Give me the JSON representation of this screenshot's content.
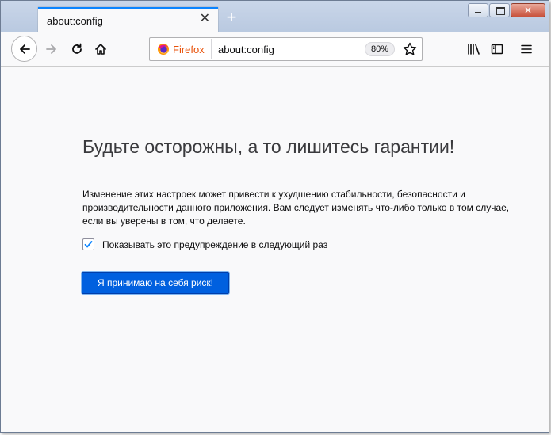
{
  "tab": {
    "title": "about:config",
    "close_glyph": "✕"
  },
  "new_tab_glyph": "+",
  "window_controls": [
    "minimize",
    "maximize",
    "close"
  ],
  "toolbar": {
    "back_icon": "back-arrow-icon",
    "forward_icon": "forward-arrow-icon",
    "reload_icon": "reload-icon",
    "home_icon": "home-icon",
    "library_icon": "library-icon",
    "sidebar_icon": "sidebar-icon",
    "menu_icon": "hamburger-menu-icon"
  },
  "urlbar": {
    "identity_label": "Firefox",
    "url": "about:config",
    "zoom": "80%"
  },
  "page": {
    "title": "Будьте осторожны, а то лишитесь гарантии!",
    "description": "Изменение этих настроек может привести к ухудшению стабильности, безопасности и производительности данного приложения. Вам следует изменять что-либо только в том случае, если вы уверены в том, что делаете.",
    "checkbox_label": "Показывать это предупреждение в следующий раз",
    "checkbox_checked": true,
    "accept_button": "Я принимаю на себя риск!"
  },
  "colors": {
    "accent": "#0a84ff",
    "button": "#0060df",
    "firefox_orange": "#e8520a"
  }
}
